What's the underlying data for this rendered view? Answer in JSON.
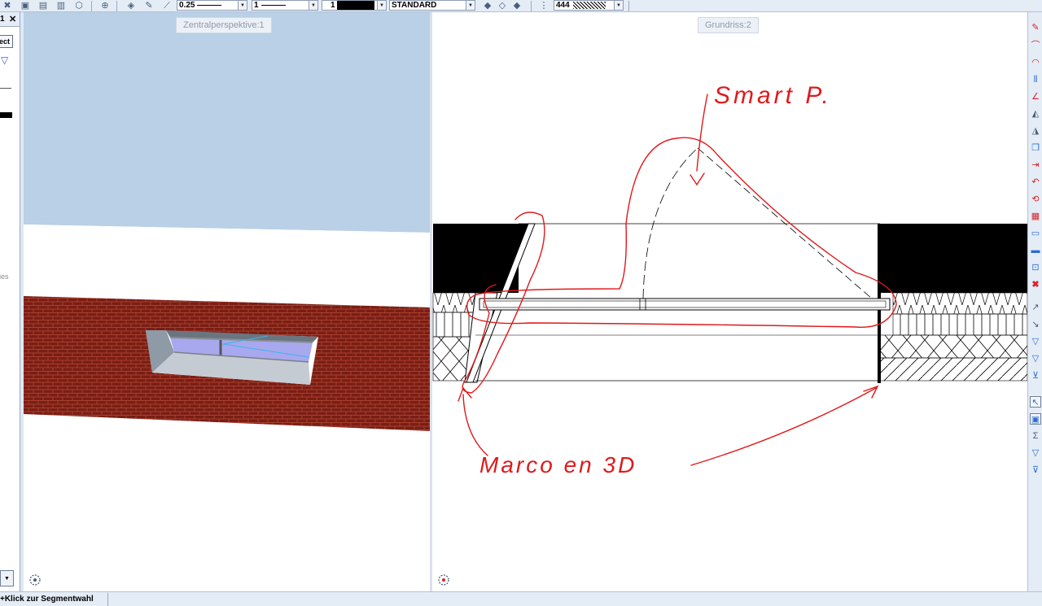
{
  "toolbar": {
    "pen_thickness": "0.25",
    "line_type": "1",
    "color_number": "1",
    "layer": "STANDARD",
    "hatch_number": "444",
    "icons": [
      "tools-icon",
      "cube-view-icon",
      "open-folder-icon",
      "duplicate-icon",
      "object-3d-icon",
      "zoom-icon",
      "pen-icon",
      "pencil-icon",
      "eyedropper-icon",
      "layer-stack-icon",
      "layer-down-icon",
      "layer-grey-icon",
      "hatch-icon"
    ]
  },
  "left_panel": {
    "number": "1",
    "close_glyph": "✕",
    "object_button": "ect",
    "values_label": "ues"
  },
  "viewports": {
    "left_title": "Zentralperspektive:1",
    "right_title": "Grundriss:2"
  },
  "annotations": {
    "smart_label": "Smart P.",
    "marco_label": "Marco en 3D",
    "ink_color": "#e0191b"
  },
  "right_toolbar": {
    "icons": [
      "red-pen-icon",
      "red-curve-icon",
      "red-arc-icon",
      "blue-dimension-icon",
      "red-angle-icon",
      "mirror-icon",
      "mirror-copy-icon",
      "copy-icon",
      "move-icon",
      "rotate-icon",
      "rotate-copy-icon",
      "array-icon",
      "stretch-icon",
      "align-icon",
      "scale-icon",
      "delete-icon",
      "modify-icon",
      "pick-icon",
      "filter-icon",
      "filter-add-icon",
      "filter-remove-icon",
      "select-icon",
      "select-window-icon",
      "sum-icon",
      "filter-funnel-icon",
      "filter-funnel-minus-icon"
    ]
  },
  "status": {
    "text": "+Klick zur Segmentwahl"
  },
  "colors": {
    "brick": "#7a1e14",
    "sky": "#b9d0e6",
    "toolbar": "#e4ecf6"
  }
}
